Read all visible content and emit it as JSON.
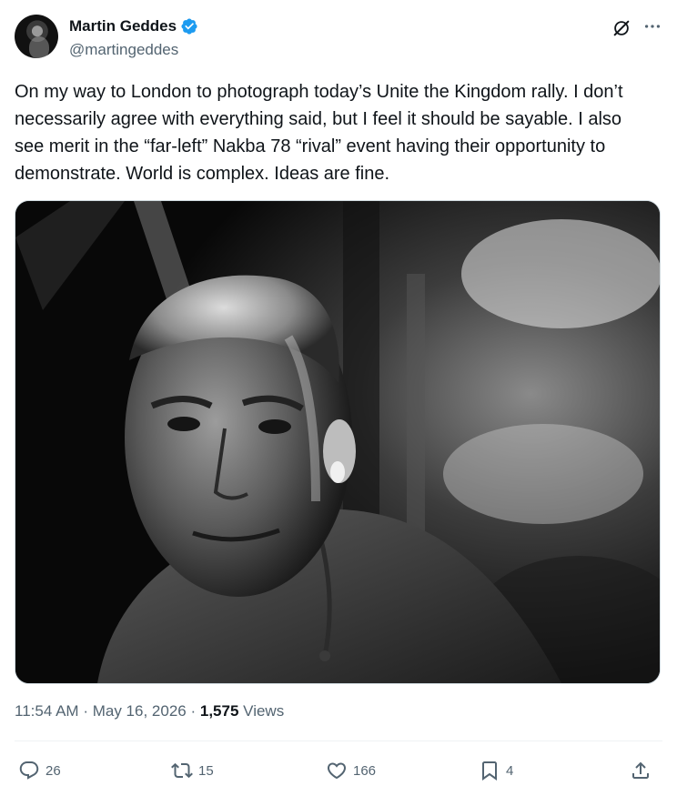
{
  "author": {
    "name": "Martin Geddes",
    "handle": "@martingeddes",
    "verified": true
  },
  "tweet": {
    "text": "On my way to London to photograph today’s Unite the Kingdom rally. I don’t necessarily agree with everything said, but I feel it should be sayable. I also see merit in the “far-left” Nakba 78 “rival” event having their opportunity to demonstrate. World is complex. Ideas are fine."
  },
  "meta": {
    "time": "11:54 AM",
    "separator": "·",
    "date": "May 16, 2026",
    "views_count": "1,575",
    "views_label": "Views"
  },
  "actions": {
    "replies": "26",
    "reposts": "15",
    "likes": "166",
    "bookmarks": "4"
  },
  "icons": [
    "verified-badge-icon",
    "grok-icon",
    "more-icon",
    "reply-icon",
    "repost-icon",
    "like-icon",
    "bookmark-icon",
    "share-icon"
  ],
  "colors": {
    "text": "#0f1419",
    "secondary": "#536471",
    "verified": "#1d9bf0",
    "border": "#cfd9de"
  }
}
